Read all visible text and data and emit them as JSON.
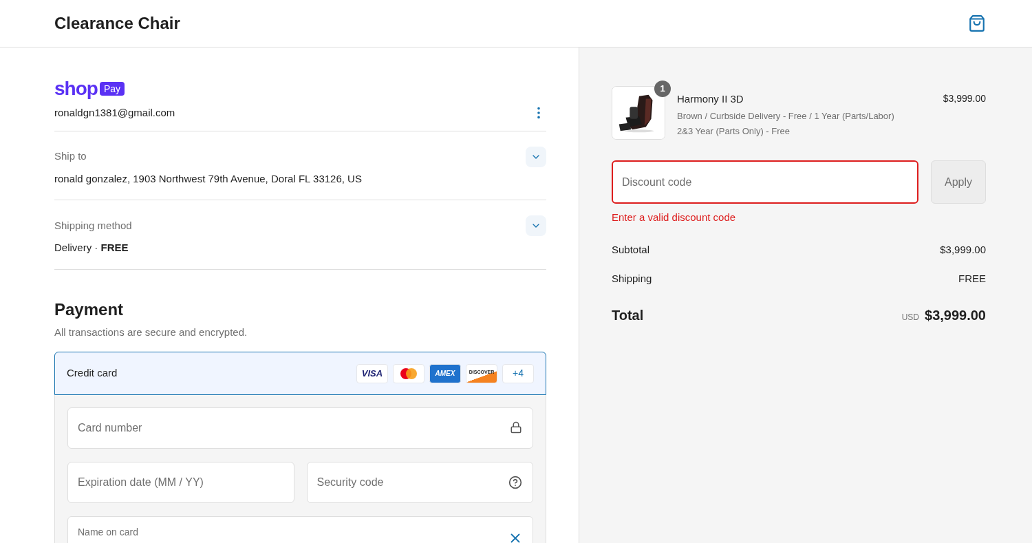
{
  "header": {
    "title": "Clearance Chair"
  },
  "shop_pay": {
    "logo_word": "shop",
    "badge": "Pay",
    "email": "ronaldgn1381@gmail.com"
  },
  "review": [
    {
      "label": "Ship to",
      "value": "ronald gonzalez, 1903 Northwest 79th Avenue, Doral FL 33126, US"
    },
    {
      "label": "Shipping method",
      "value": "Delivery · **FREE**"
    }
  ],
  "payment": {
    "title": "Payment",
    "subtitle": "All transactions are secure and encrypted.",
    "methods": [
      {
        "label": "Credit card",
        "selected": true,
        "cards": [
          {
            "kind": "visa",
            "label": "VISA"
          },
          {
            "kind": "mastercard"
          },
          {
            "kind": "amex",
            "label": "AMEX"
          },
          {
            "kind": "discover",
            "label": "DISCOVER"
          },
          {
            "kind": "more",
            "label": "+4"
          }
        ]
      }
    ],
    "fields": [
      {
        "kind": "full",
        "placeholder": "Card number",
        "trailing": {
          "kind": "lock"
        }
      },
      {
        "kind": "half",
        "placeholder": "Expiration date (MM / YY)"
      },
      {
        "kind": "half",
        "placeholder": "Security code",
        "trailing": {
          "kind": "help"
        }
      },
      {
        "kind": "floating",
        "label": "Name on card",
        "trailing": {
          "kind": "clear"
        }
      }
    ]
  },
  "order": {
    "items": [
      {
        "quantity": "1",
        "name": "Harmony II 3D",
        "variant_lines": [
          "Brown / Curbside Delivery - Free / 1 Year (Parts/Labor)",
          "2&3 Year (Parts Only) - Free"
        ],
        "price": "$3,999.00"
      }
    ],
    "discount": {
      "placeholder": "Discount code",
      "invalid": true,
      "error": "Enter a valid discount code",
      "button": "Apply",
      "button_disabled": true
    },
    "lines": [
      {
        "label": "Subtotal",
        "value": "$3,999.00"
      },
      {
        "label": "Shipping",
        "value": "FREE"
      }
    ],
    "total": {
      "label": "Total",
      "currency": "USD",
      "amount": "$3,999.00"
    }
  }
}
